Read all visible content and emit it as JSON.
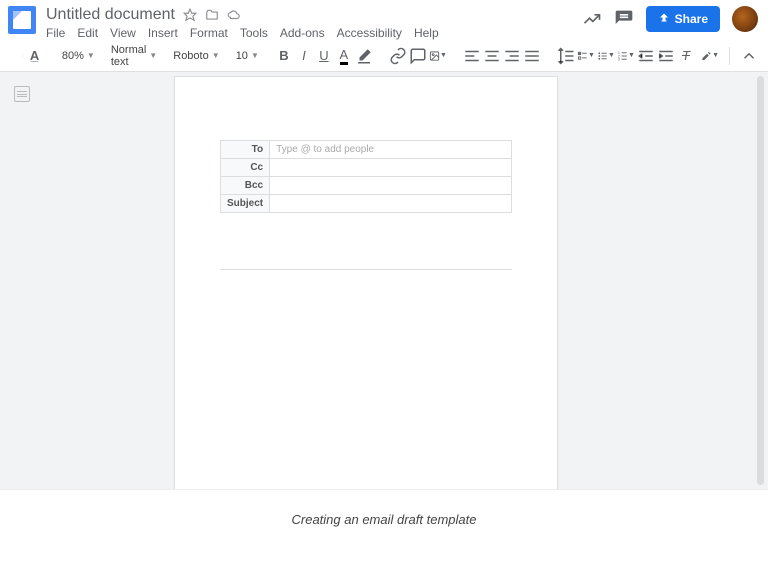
{
  "header": {
    "title": "Untitled document",
    "menus": [
      "File",
      "Edit",
      "View",
      "Insert",
      "Format",
      "Tools",
      "Add-ons",
      "Accessibility",
      "Help"
    ],
    "share_label": "Share"
  },
  "toolbar": {
    "zoom": "80%",
    "style": "Normal text",
    "font": "Roboto",
    "size": "10"
  },
  "email": {
    "to_label": "To",
    "to_placeholder": "Type @ to add people",
    "cc_label": "Cc",
    "bcc_label": "Bcc",
    "subject_label": "Subject"
  },
  "caption": "Creating an email draft template"
}
